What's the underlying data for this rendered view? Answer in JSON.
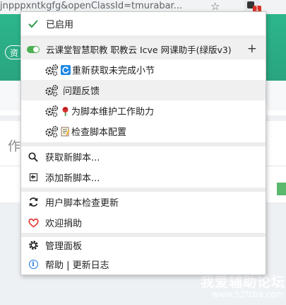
{
  "browser": {
    "url_fragment": "jnpppxntkgfg&openClassId=tmurabar...",
    "ext_badge_count": "1"
  },
  "background": {
    "side_text": "作",
    "green_button_text": "资"
  },
  "menu": {
    "enabled_label": "已启用",
    "script_name": "云课堂智慧职教 职教云 Icve 网课助手(绿版v3)",
    "script_commands": [
      {
        "label": "重新获取未完成小节"
      },
      {
        "label": "问题反馈"
      },
      {
        "label": "为脚本维护工作助力"
      },
      {
        "label": "检查脚本配置"
      }
    ],
    "find_scripts_label": "获取新脚本...",
    "add_script_label": "添加新脚本...",
    "check_updates_label": "用户脚本检查更新",
    "donate_label": "欢迎捐助",
    "dashboard_label": "管理面板",
    "help_label": "帮助 | 更新日志"
  },
  "watermark": {
    "title": "我爱辅助论坛",
    "url": "www.52fzba.com"
  },
  "colors": {
    "accent_green": "#4caf50",
    "header_green": "#2aa57f",
    "check_green": "#2e9b4a",
    "heart_red": "#e53935",
    "info_blue": "#1a73e8"
  }
}
